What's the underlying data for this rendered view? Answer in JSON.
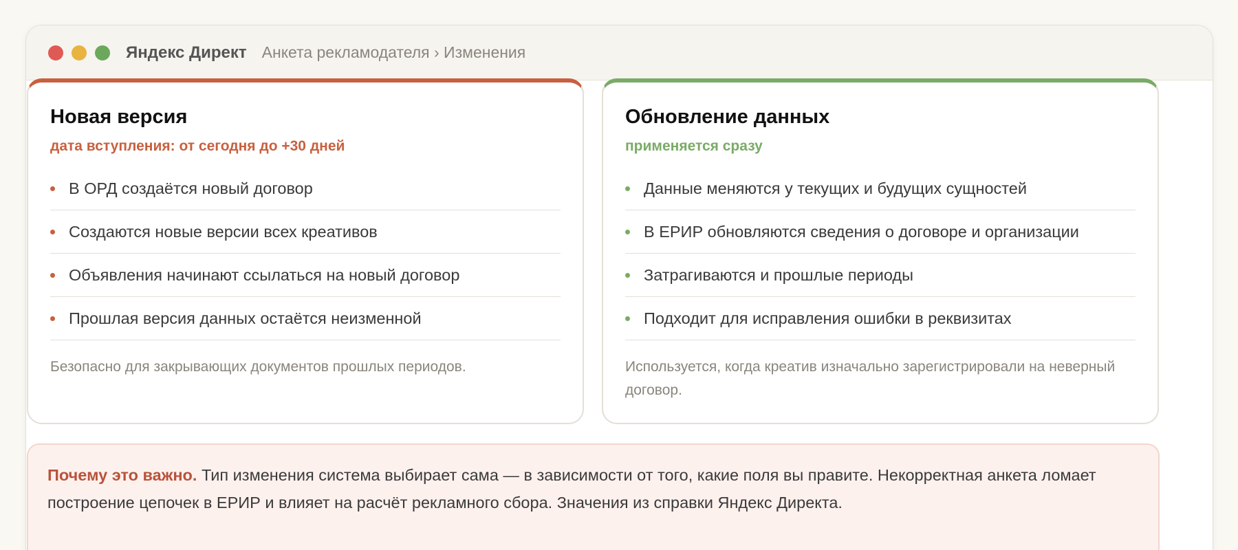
{
  "window": {
    "app_name": "Яндекс Директ",
    "breadcrumb": "Анкета рекламодателя › Изменения"
  },
  "cards": [
    {
      "title": "Новая версия",
      "subtitle": "дата вступления: от сегодня до +30 дней",
      "accent": "#c8603f",
      "items": [
        "В ОРД создаётся новый договор",
        "Создаются новые версии всех креативов",
        "Объявления начинают ссылаться на новый договор",
        "Прошлая версия данных остаётся неизменной"
      ],
      "note": "Безопасно для закрывающих документов прошлых периодов."
    },
    {
      "title": "Обновление данных",
      "subtitle": "применяется сразу",
      "accent": "#7aab66",
      "items": [
        "Данные меняются у текущих и будущих сущностей",
        "В ЕРИР обновляются сведения о договоре и организации",
        "Затрагиваются и прошлые периоды",
        "Подходит для исправления ошибки в реквизитах"
      ],
      "note": "Используется, когда креатив изначально зарегистрировали на неверный договор."
    }
  ],
  "notice": {
    "strong": "Почему это важно.",
    "text": " Тип изменения система выбирает сама — в зависимости от того, какие поля вы правите. Некорректная анкета ломает построение цепочек в ЕРИР и влияет на расчёт рекламного сбора. Значения из справки Яндекс Директа."
  }
}
